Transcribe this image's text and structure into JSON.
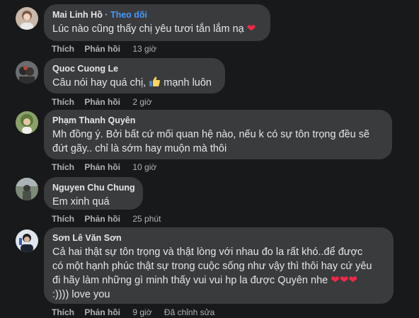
{
  "comments": [
    {
      "author": "Mai Linh Hồ",
      "separator": " · ",
      "follow_label": "Theo dõi",
      "text": "Lúc nào cũng thấy chị yêu tươi tắn lắm nạ",
      "emoji": "❤",
      "like_label": "Thích",
      "reply_label": "Phản hồi",
      "time": "13 giờ"
    },
    {
      "author": "Quoc Cuong Le",
      "text_before": "Câu nói hay quá chị,",
      "emoji_icon": "thumbs-up-icon",
      "text_after": "mạnh luôn",
      "like_label": "Thích",
      "reply_label": "Phản hồi",
      "time": "2 giờ"
    },
    {
      "author": "Phạm Thanh Quyên",
      "lines": [
        "Mh đồng ý. Bởi bất cứ mối quan hệ nào, nếu k có sự tôn trọng đều sẽ",
        "đứt gãy.. chỉ là sớm hay muộn mà thôi"
      ],
      "like_label": "Thích",
      "reply_label": "Phản hồi",
      "time": "10 giờ"
    },
    {
      "author": "Nguyen Chu Chung",
      "text": "Em xinh quá",
      "like_label": "Thích",
      "reply_label": "Phản hồi",
      "time": "25 phút"
    },
    {
      "author": "Sơn Lê Văn Sơn",
      "lines": [
        "Cả hai thật sự tôn trọng và thật lòng với nhau đo la rất khó..để được",
        "có một hạnh phúc thật sự trong cuộc sống như vậy thì thôi hay cứ yêu",
        "đi hãy làm những gì minh thấy vui vui hp la được Quyên nhe",
        ":)))) love you"
      ],
      "emoji": "❤❤❤",
      "like_label": "Thích",
      "reply_label": "Phản hồi",
      "time": "9 giờ",
      "edited_label": "Đã chỉnh sửa"
    }
  ],
  "colors": {
    "background": "#18191a",
    "bubble": "#3a3b3c",
    "text": "#e4e6eb",
    "secondary": "#b0b3b8",
    "follow": "#4599ff",
    "heart": "#f02849"
  }
}
